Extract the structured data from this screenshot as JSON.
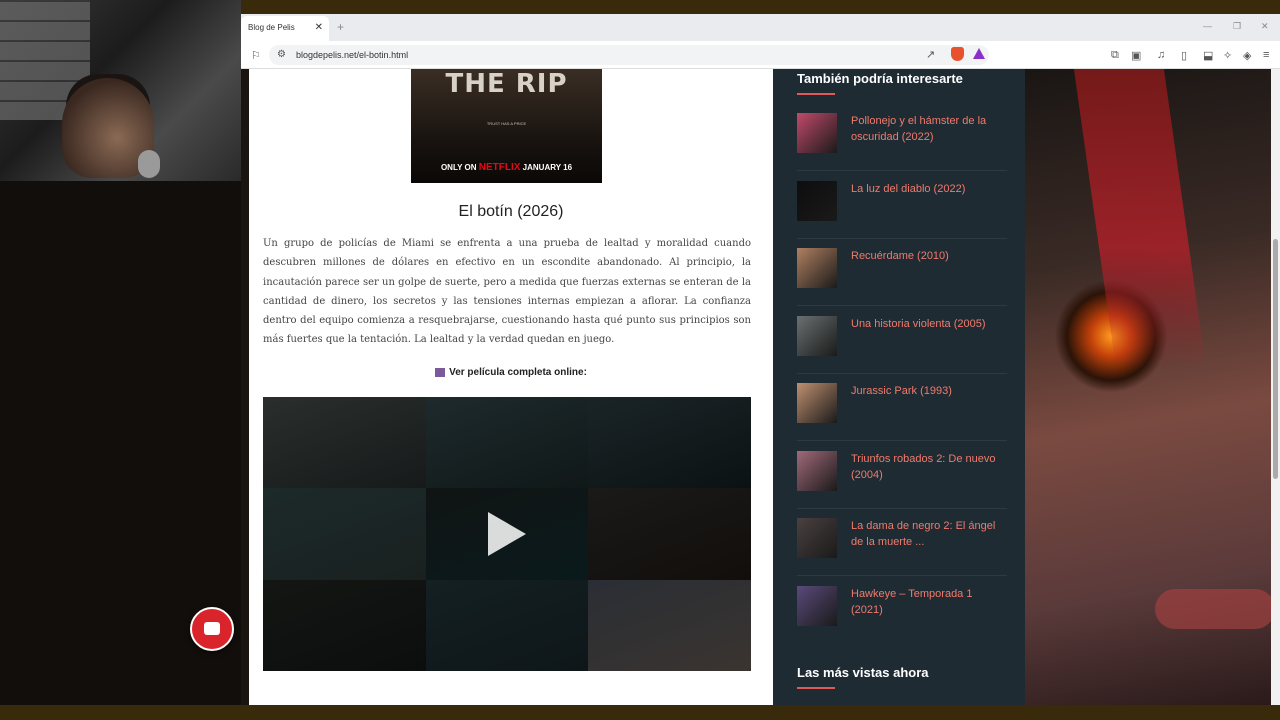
{
  "browser": {
    "tab_title": "Blog de Pelis",
    "url": "blogdepelis.net/el-botin.html"
  },
  "poster": {
    "title": "THE RIP",
    "tagline": "TRUST HAS A PRICE",
    "platform_prefix": "ONLY ON",
    "platform": "NETFLIX",
    "release": "JANUARY 16"
  },
  "article": {
    "title": "El botín (2026)",
    "synopsis": "Un grupo de policías de Miami se enfrenta a una prueba de lealtad y moralidad cuando descubren millones de dólares en efectivo en un escondite abandonado. Al principio, la incautación parece ser un golpe de suerte, pero a medida que fuerzas externas se enteran de la cantidad de dinero, los secretos y las tensiones internas empiezan a aflorar. La confianza dentro del equipo comienza a resquebrajarse, cuestionando hasta qué punto sus principios son más fuertes que la tentación. La lealtad y la verdad quedan en juego.",
    "watch_label": "Ver película completa online:"
  },
  "sidebar": {
    "heading": "También podría interesarte",
    "items": [
      {
        "label": "Pollonejo y el hámster de la oscuridad (2022)",
        "color": "#c24a6a"
      },
      {
        "label": "La luz del diablo (2022)",
        "color": "#0d0d0d"
      },
      {
        "label": "Recuérdame (2010)",
        "color": "#b08060"
      },
      {
        "label": "Una historia violenta (2005)",
        "color": "#6a7070"
      },
      {
        "label": "Jurassic Park (1993)",
        "color": "#c09070"
      },
      {
        "label": "Triunfos robados 2: De nuevo (2004)",
        "color": "#a06a7a"
      },
      {
        "label": "La dama de negro 2: El ángel de la muerte ...",
        "color": "#4a4040"
      },
      {
        "label": "Hawkeye – Temporada 1 (2021)",
        "color": "#5a4a7a"
      }
    ],
    "heading2": "Las más vistas ahora"
  },
  "colors": {
    "accent": "#e05a5a",
    "link": "#f07a6c",
    "sidebar_bg": "#1f2b33",
    "chat_button": "#d9242b"
  }
}
